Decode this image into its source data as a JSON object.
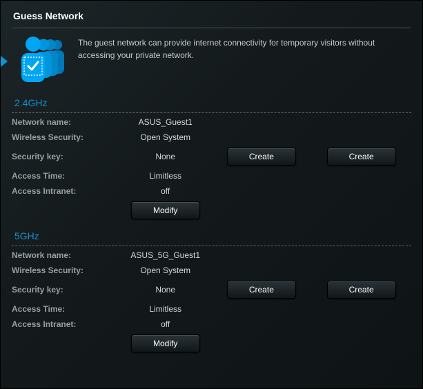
{
  "title": "Guess Network",
  "intro": "The guest network can provide internet connectivity for temporary visitors without accessing your private network.",
  "bands": {
    "g24": {
      "title": "2.4GHz",
      "labels": {
        "name": "Network name:",
        "sec": "Wireless Security:",
        "key": "Security key:",
        "time": "Access Time:",
        "intra": "Access Intranet:"
      },
      "values": {
        "name": "ASUS_Guest1",
        "sec": "Open System",
        "key": "None",
        "time": "Limitless",
        "intra": "off"
      },
      "buttons": {
        "create1": "Create",
        "create2": "Create",
        "modify": "Modify"
      }
    },
    "g5": {
      "title": "5GHz",
      "labels": {
        "name": "Network name:",
        "sec": "Wireless Security:",
        "key": "Security key:",
        "time": "Access Time:",
        "intra": "Access Intranet:"
      },
      "values": {
        "name": "ASUS_5G_Guest1",
        "sec": "Open System",
        "key": "None",
        "time": "Limitless",
        "intra": "off"
      },
      "buttons": {
        "create1": "Create",
        "create2": "Create",
        "modify": "Modify"
      }
    }
  }
}
